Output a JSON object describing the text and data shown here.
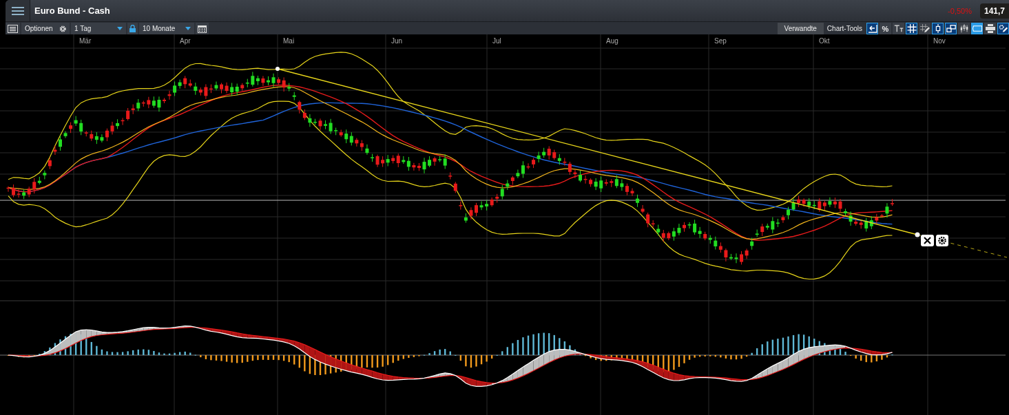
{
  "window": {
    "title": "Euro Bund - Cash"
  },
  "quote": {
    "change": "-0,50%",
    "price": "141,7"
  },
  "toolbar": {
    "options_label": "Optionen",
    "interval": "1 Tag",
    "period": "10 Monate",
    "related_tab": "Verwandte",
    "tools_label": "Chart-Tools",
    "tools": [
      {
        "kind": "crosshair-back",
        "selected": true
      },
      {
        "kind": "percent",
        "label": "%",
        "selected": false
      },
      {
        "kind": "text-size",
        "selected": false
      },
      {
        "kind": "grid",
        "selected": true
      },
      {
        "kind": "grid-pen",
        "selected": false
      },
      {
        "kind": "candle",
        "selected": true
      },
      {
        "kind": "compare",
        "selected": true
      },
      {
        "kind": "candles",
        "selected": false
      },
      {
        "kind": "tag",
        "selected": true
      },
      {
        "kind": "print",
        "selected": false
      },
      {
        "kind": "settings-pen",
        "selected": true
      }
    ]
  },
  "chart": {
    "months": [
      "Mär",
      "Apr",
      "Mai",
      "Jun",
      "Jul",
      "Aug",
      "Sep",
      "Okt",
      "Nov"
    ]
  }
}
